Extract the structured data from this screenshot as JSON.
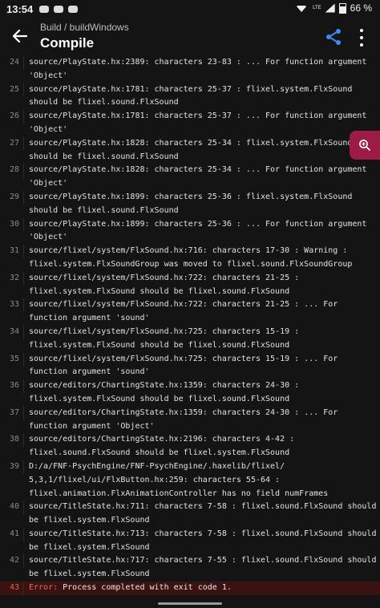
{
  "status_bar": {
    "time": "13:54",
    "network": "LTE",
    "battery": "66 %"
  },
  "app_bar": {
    "breadcrumb": "Build / buildWindows",
    "title": "Compile",
    "icons": [
      "back-arrow-icon",
      "share-icon",
      "more-vert-icon"
    ]
  },
  "log": {
    "lines": [
      {
        "num": "24",
        "text": "source/PlayState.hx:2389: characters 23-83 : ... For function argument\n'Object'"
      },
      {
        "num": "25",
        "text": "source/PlayState.hx:1781: characters 25-37 : flixel.system.FlxSound\nshould be flixel.sound.FlxSound"
      },
      {
        "num": "26",
        "text": "source/PlayState.hx:1781: characters 25-37 : ... For function argument\n'Object'"
      },
      {
        "num": "27",
        "text": "source/PlayState.hx:1828: characters 25-34 : flixel.system.FlxSound\nshould be flixel.sound.FlxSound"
      },
      {
        "num": "28",
        "text": "source/PlayState.hx:1828: characters 25-34 : ... For function argument\n'Object'"
      },
      {
        "num": "29",
        "text": "source/PlayState.hx:1899: characters 25-36 : flixel.system.FlxSound\nshould be flixel.sound.FlxSound"
      },
      {
        "num": "30",
        "text": "source/PlayState.hx:1899: characters 25-36 : ... For function argument\n'Object'"
      },
      {
        "num": "31",
        "text": "source/flixel/system/FlxSound.hx:716: characters 17-30 : Warning :\nflixel.system.FlxSoundGroup was moved to flixel.sound.FlxSoundGroup"
      },
      {
        "num": "32",
        "text": "source/flixel/system/FlxSound.hx:722: characters 21-25 :\nflixel.system.FlxSound should be flixel.sound.FlxSound"
      },
      {
        "num": "33",
        "text": "source/flixel/system/FlxSound.hx:722: characters 21-25 : ... For\nfunction argument 'sound'"
      },
      {
        "num": "34",
        "text": "source/flixel/system/FlxSound.hx:725: characters 15-19 :\nflixel.system.FlxSound should be flixel.sound.FlxSound"
      },
      {
        "num": "35",
        "text": "source/flixel/system/FlxSound.hx:725: characters 15-19 : ... For\nfunction argument 'sound'"
      },
      {
        "num": "36",
        "text": "source/editors/ChartingState.hx:1359: characters 24-30 :\nflixel.system.FlxSound should be flixel.sound.FlxSound"
      },
      {
        "num": "37",
        "text": "source/editors/ChartingState.hx:1359: characters 24-30 : ... For\nfunction argument 'Object'"
      },
      {
        "num": "38",
        "text": "source/editors/ChartingState.hx:2196: characters 4-42 :\nflixel.sound.FlxSound should be flixel.system.FlxSound"
      },
      {
        "num": "39",
        "text": "D:/a/FNF-PsychEngine/FNF-PsychEngine/.haxelib/flixel/\n5,3,1/flixel/ui/FlxButton.hx:259: characters 55-64 :\nflixel.animation.FlxAnimationController has no field numFrames"
      },
      {
        "num": "40",
        "text": "source/TitleState.hx:711: characters 7-58 : flixel.sound.FlxSound should\nbe flixel.system.FlxSound"
      },
      {
        "num": "41",
        "text": "source/TitleState.hx:713: characters 7-58 : flixel.sound.FlxSound should\nbe flixel.system.FlxSound"
      },
      {
        "num": "42",
        "text": "source/TitleState.hx:717: characters 7-55 : flixel.sound.FlxSound should\nbe flixel.system.FlxSound"
      }
    ],
    "error_line": {
      "num": "43",
      "label": "Error:",
      "text": " Process completed with exit code 1."
    }
  },
  "fab": {
    "icon": "zoom-in-icon"
  },
  "colors": {
    "background": "#141414",
    "error_row": "#3a1212",
    "error_text": "#e86a66",
    "fab": "#9c1c46",
    "accent": "#3d8bf2"
  }
}
